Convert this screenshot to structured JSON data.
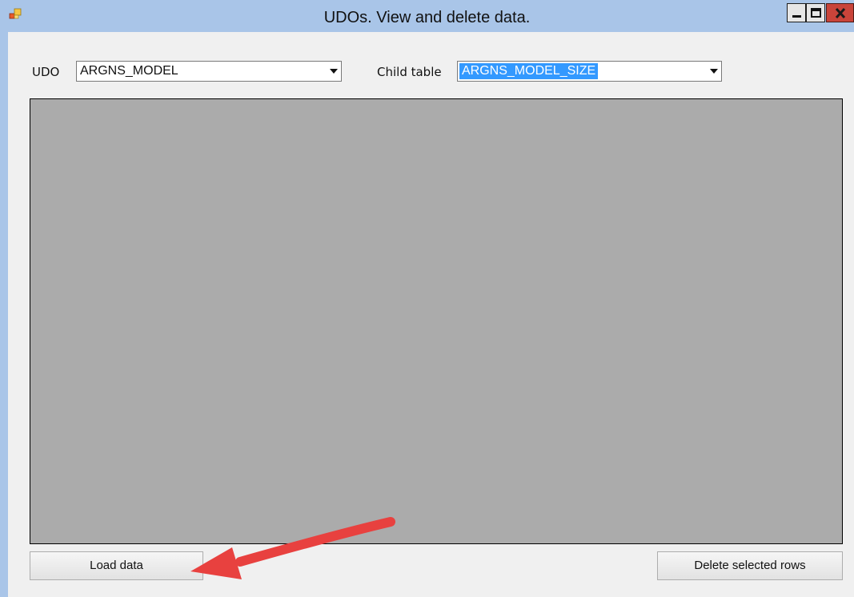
{
  "window": {
    "title": "UDOs. View and delete data."
  },
  "udo": {
    "label": "UDO",
    "selected": "ARGNS_MODEL"
  },
  "child_table": {
    "label": "Child table",
    "selected": "ARGNS_MODEL_SIZE"
  },
  "buttons": {
    "load_data": "Load data",
    "delete_selected_rows": "Delete selected rows"
  },
  "colors": {
    "titlebar": "#a9c5e8",
    "grid_background": "#ababab",
    "selection": "#3399ff",
    "annotation_arrow": "#e8413f"
  },
  "icons": {
    "app": "app-icon",
    "minimize": "minimize-icon",
    "maximize": "maximize-icon",
    "close": "close-icon",
    "dropdown": "chevron-down-icon",
    "annotation": "annotation-arrow"
  }
}
